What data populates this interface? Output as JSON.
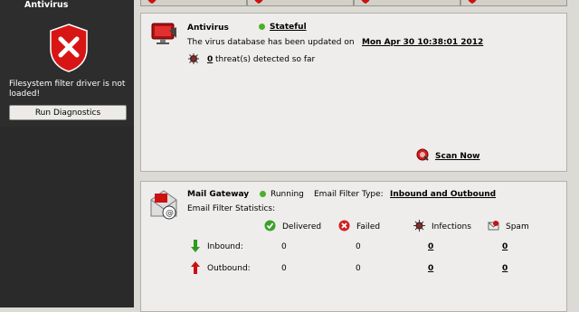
{
  "sidebar": {
    "title": "Antivirus",
    "status_message": "Filesystem filter driver is not loaded!",
    "run_diagnostics_label": "Run Diagnostics"
  },
  "antivirus": {
    "heading": "Antivirus",
    "state": "Stateful",
    "db_prefix": "The virus database has been updated on",
    "db_date": "Mon Apr 30 10:38:01 2012",
    "threat_count": "0",
    "threat_suffix": "threat(s) detected so far",
    "scan_now_label": "Scan Now"
  },
  "mail_gateway": {
    "heading": "Mail Gateway",
    "status": "Running",
    "filter_type_label": "Email Filter Type:",
    "filter_type_value": "Inbound and Outbound",
    "stats_label": "Email Filter Statistics:",
    "columns": [
      "Delivered",
      "Failed",
      "Infections",
      "Spam"
    ],
    "rows": [
      {
        "label": "Inbound:",
        "delivered": "0",
        "failed": "0",
        "infections": "0",
        "spam": "0"
      },
      {
        "label": "Outbound:",
        "delivered": "0",
        "failed": "0",
        "infections": "0",
        "spam": "0"
      }
    ]
  },
  "colors": {
    "status_green": "#4caf2a",
    "alert_red": "#cc1111",
    "sidebar_bg": "#2d2d2d"
  },
  "icons": [
    "shield-icon",
    "monitor-icon",
    "virus-icon",
    "scan-icon",
    "mail-icon",
    "delivered-icon",
    "failed-icon",
    "infections-icon",
    "spam-icon",
    "inbound-arrow-icon",
    "outbound-arrow-icon"
  ]
}
